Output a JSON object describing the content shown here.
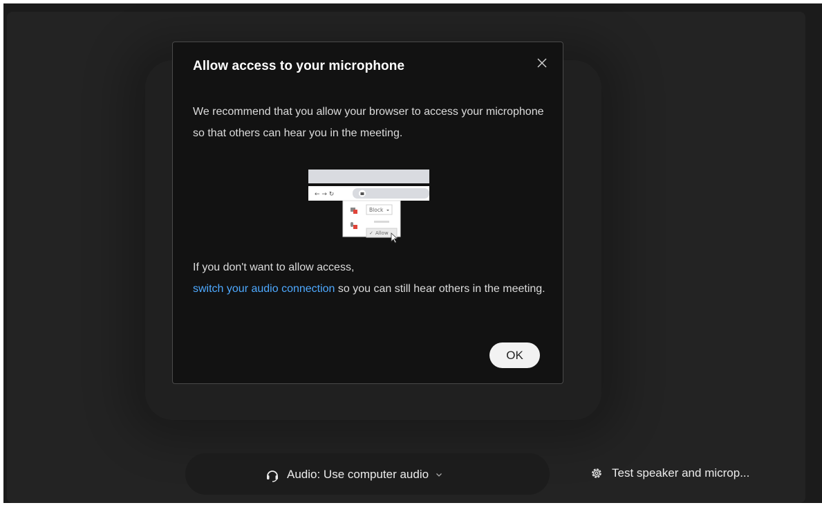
{
  "dialog": {
    "title": "Allow access to your microphone",
    "close_icon": "close-icon",
    "message": "We recommend that you allow your browser to access your microphone so that others can hear you in the meeting.",
    "alt_prefix": "If you don't want to allow access,",
    "alt_link": "switch your audio connection",
    "alt_suffix": " so you can still hear others in the meeting.",
    "illustration": {
      "block_label": "Block",
      "allow_label": "Allow"
    },
    "ok_label": "OK"
  },
  "footer": {
    "audio_icon": "headset-icon",
    "audio_label": "Audio: Use computer audio",
    "audio_chevron": "chevron-down-icon",
    "settings_icon": "gear-icon",
    "test_label": "Test speaker and microp..."
  },
  "colors": {
    "background": "#1b1b1b",
    "dialog": "#121212",
    "link": "#4ea9ff",
    "ok_button": "#f2f2f2"
  }
}
